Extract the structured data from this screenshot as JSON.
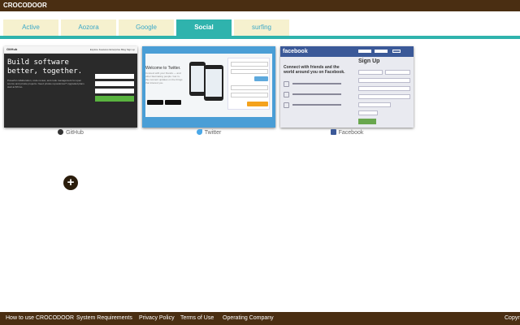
{
  "app": {
    "title": "CROCODOOR"
  },
  "tabs": [
    {
      "label": "Active",
      "active": false
    },
    {
      "label": "Aozora",
      "active": false
    },
    {
      "label": "Google",
      "active": false
    },
    {
      "label": "Social",
      "active": true
    },
    {
      "label": "surfing",
      "active": false
    }
  ],
  "bookmarks": [
    {
      "label": "GitHub",
      "icon": "github-icon",
      "thumbnail": {
        "logo": "GitHub",
        "nav": "Explore  Features  Enterprise  Blog   Sign up",
        "headline": "Build software better, together.",
        "subtext": "Powerful collaboration, code review, and code management for open source and private projects. Need private repositories? Upgraded plans start at $7/mo."
      }
    },
    {
      "label": "Twitter",
      "icon": "twitter-bird-icon",
      "thumbnail": {
        "headline": "Welcome to Twitter.",
        "subtext": "Connect with your friends — and other fascinating people. Get in-the-moment updates on the things that interest you."
      }
    },
    {
      "label": "Facebook",
      "icon": "facebook-icon",
      "thumbnail": {
        "logo": "facebook",
        "tagline": "Connect with friends and the world around you on Facebook.",
        "signup": "Sign Up"
      }
    }
  ],
  "add_button": {
    "symbol": "+"
  },
  "footer": {
    "links": [
      "How to use CROCODOOR",
      "System Requirements",
      "Privacy Policy",
      "Terms of Use",
      "Operating Company"
    ],
    "copyright": "Copyr"
  },
  "colors": {
    "brand_bar": "#4a2e12",
    "tab_active": "#2fb3ad",
    "tab_inactive": "#f6f1cf",
    "tab_text": "#3aa8c8"
  }
}
